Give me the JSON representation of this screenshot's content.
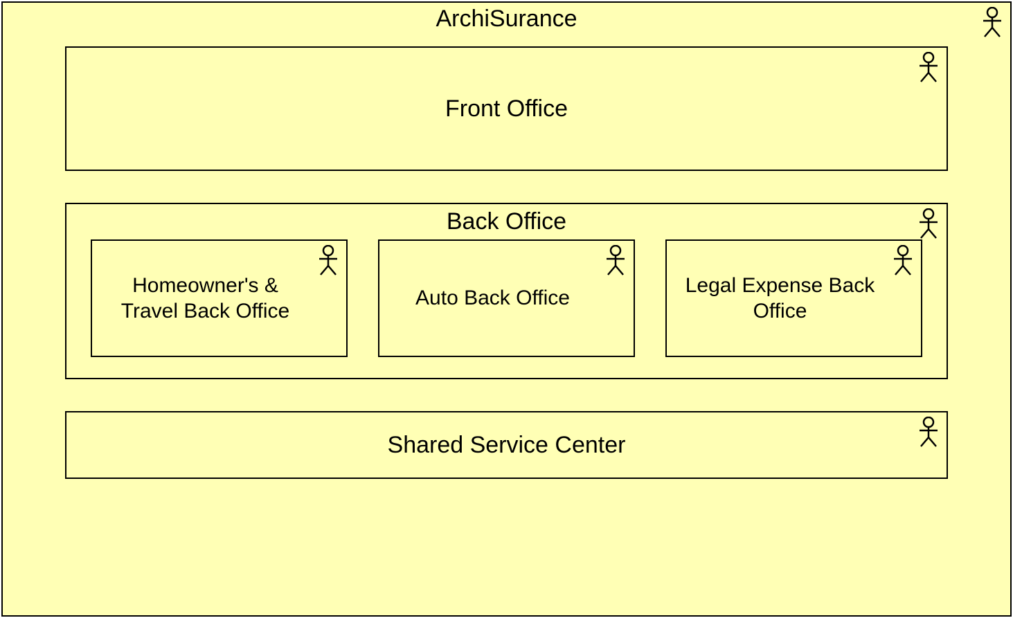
{
  "diagram": {
    "title": "ArchiSurance",
    "front_office": "Front Office",
    "back_office": {
      "title": "Back Office",
      "children": [
        "Homeowner's & Travel Back Office",
        "Auto Back Office",
        "Legal Expense Back Office"
      ]
    },
    "shared_service_center": "Shared Service Center"
  },
  "icons": {
    "actor": "actor"
  }
}
